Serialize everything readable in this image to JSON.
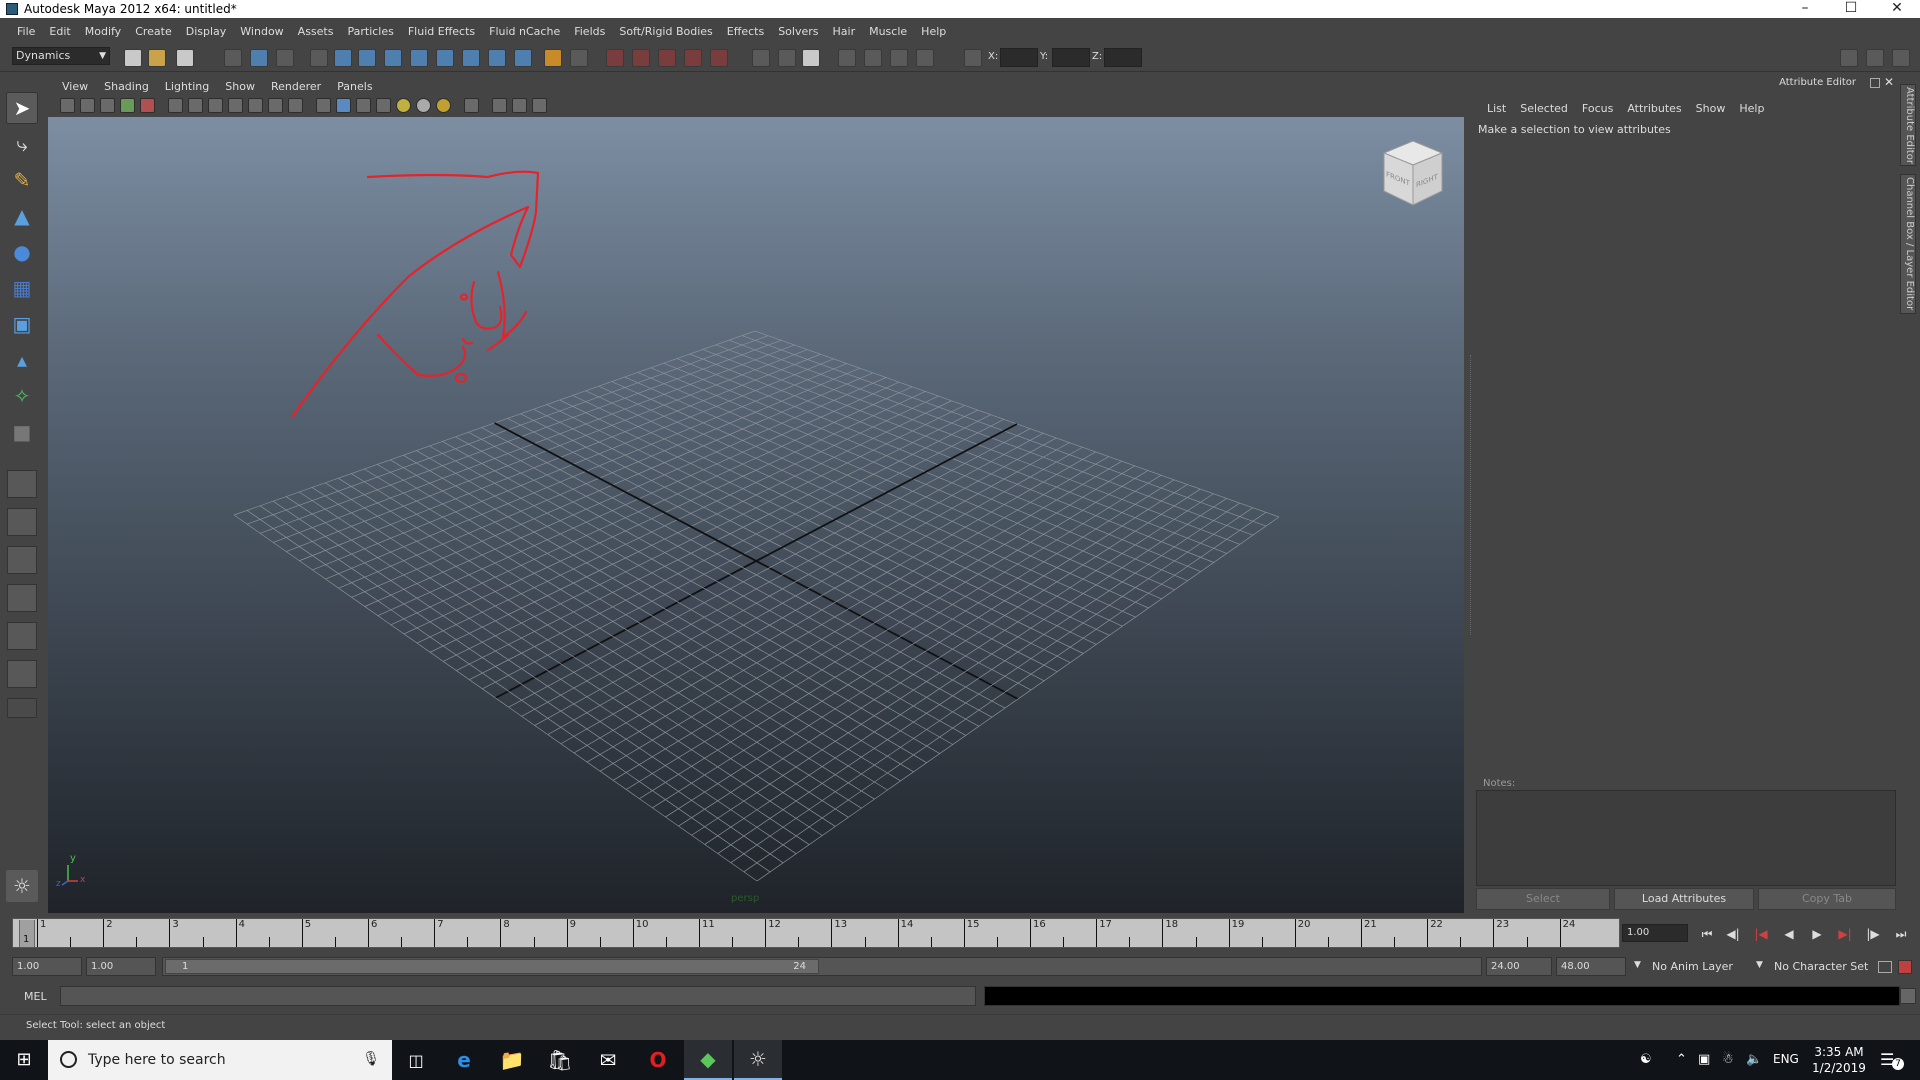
{
  "window": {
    "title": "Autodesk Maya 2012 x64: untitled*"
  },
  "menubar": {
    "items": [
      "File",
      "Edit",
      "Modify",
      "Create",
      "Display",
      "Window",
      "Assets",
      "Particles",
      "Fluid Effects",
      "Fluid nCache",
      "Fields",
      "Soft/Rigid Bodies",
      "Effects",
      "Solvers",
      "Hair",
      "Muscle",
      "Help"
    ]
  },
  "statusline": {
    "mode": "Dynamics",
    "x_label": "X:",
    "y_label": "Y:",
    "z_label": "Z:"
  },
  "panel": {
    "menus": [
      "View",
      "Shading",
      "Lighting",
      "Show",
      "Renderer",
      "Panels"
    ],
    "camera_label": "persp",
    "viewcube": {
      "front": "FRONT",
      "right": "RIGHT"
    },
    "axis": {
      "y": "y",
      "z": "z",
      "x": "x"
    },
    "annotation_color": "#e5232a"
  },
  "attribute_editor": {
    "title": "Attribute Editor",
    "menus": [
      "List",
      "Selected",
      "Focus",
      "Attributes",
      "Show",
      "Help"
    ],
    "message": "Make a selection to view attributes",
    "notes_label": "Notes:",
    "buttons": {
      "select": "Select",
      "load": "Load Attributes",
      "copy": "Copy Tab"
    },
    "side_tabs": [
      "Attribute Editor",
      "Channel Box / Layer Editor"
    ]
  },
  "timeline": {
    "frames": [
      "1",
      "2",
      "3",
      "4",
      "5",
      "6",
      "7",
      "8",
      "9",
      "10",
      "11",
      "12",
      "13",
      "14",
      "15",
      "16",
      "17",
      "18",
      "19",
      "20",
      "21",
      "22",
      "23",
      "24"
    ],
    "current_frame": "1",
    "current_time": "1.00"
  },
  "range": {
    "anim_start": "1.00",
    "playback_start": "1.00",
    "range_start_label": "1",
    "range_end_label": "24",
    "playback_end": "24.00",
    "anim_end": "48.00",
    "anim_layer": "No Anim Layer",
    "character_set": "No Character Set"
  },
  "command_line": {
    "label": "MEL"
  },
  "help_line": {
    "text": "Select Tool: select an object"
  },
  "taskbar": {
    "search_placeholder": "Type here to search",
    "language": "ENG",
    "time": "3:35 AM",
    "date": "1/2/2019",
    "notification_count": "7"
  }
}
